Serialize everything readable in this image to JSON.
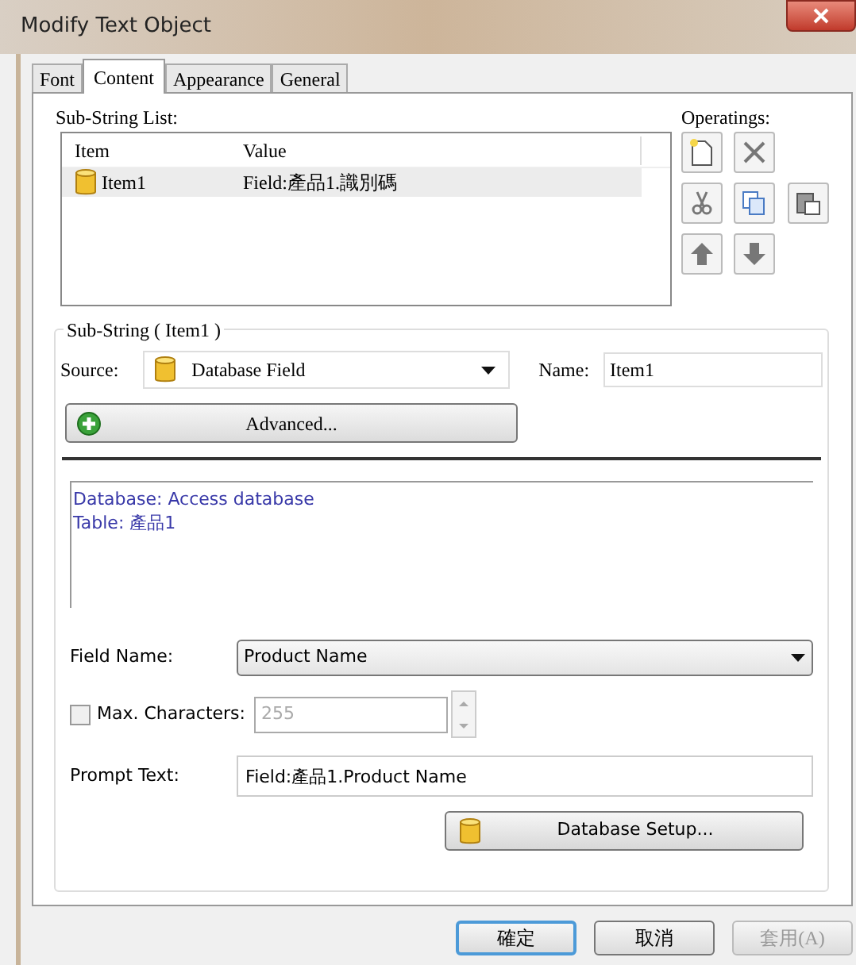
{
  "window": {
    "title": "Modify Text Object"
  },
  "tabs": [
    {
      "label": "Font",
      "selected": false
    },
    {
      "label": "Content",
      "selected": true
    },
    {
      "label": "Appearance",
      "selected": false
    },
    {
      "label": "General",
      "selected": false
    }
  ],
  "substring_list": {
    "label": "Sub-String List:",
    "columns": [
      "Item",
      "Value"
    ],
    "rows": [
      {
        "item": "Item1",
        "value": "Field:產品1.識別碼",
        "selected": true
      }
    ]
  },
  "operations": {
    "label": "Operatings:",
    "buttons": [
      {
        "kind": "new",
        "disabled": false
      },
      {
        "kind": "delete",
        "disabled": false
      },
      {
        "kind": "cut",
        "disabled": false
      },
      {
        "kind": "copy",
        "disabled": false
      },
      {
        "kind": "paste",
        "disabled": false
      },
      {
        "kind": "up",
        "disabled": false
      },
      {
        "kind": "down",
        "disabled": false
      }
    ]
  },
  "substring": {
    "title": "Sub-String ( Item1 )",
    "source_label": "Source:",
    "source_value": "Database Field",
    "name_label": "Name:",
    "name_value": "Item1",
    "advanced_button": "Advanced..."
  },
  "info_lines": [
    "Database: Access database",
    "Table: 產品1"
  ],
  "field_name": {
    "label": "Field Name:",
    "value": "Product Name"
  },
  "max_characters": {
    "label": "Max. Characters:",
    "checked": false,
    "value": "255"
  },
  "prompt_text": {
    "label": "Prompt Text:",
    "value": "Field:產品1.Product Name"
  },
  "database_setup_button": "Database Setup...",
  "buttons": [
    {
      "label": "確定",
      "default": true,
      "disabled": false
    },
    {
      "label": "取消",
      "default": false,
      "disabled": false
    },
    {
      "label": "套用(A)",
      "default": false,
      "disabled": true
    }
  ]
}
